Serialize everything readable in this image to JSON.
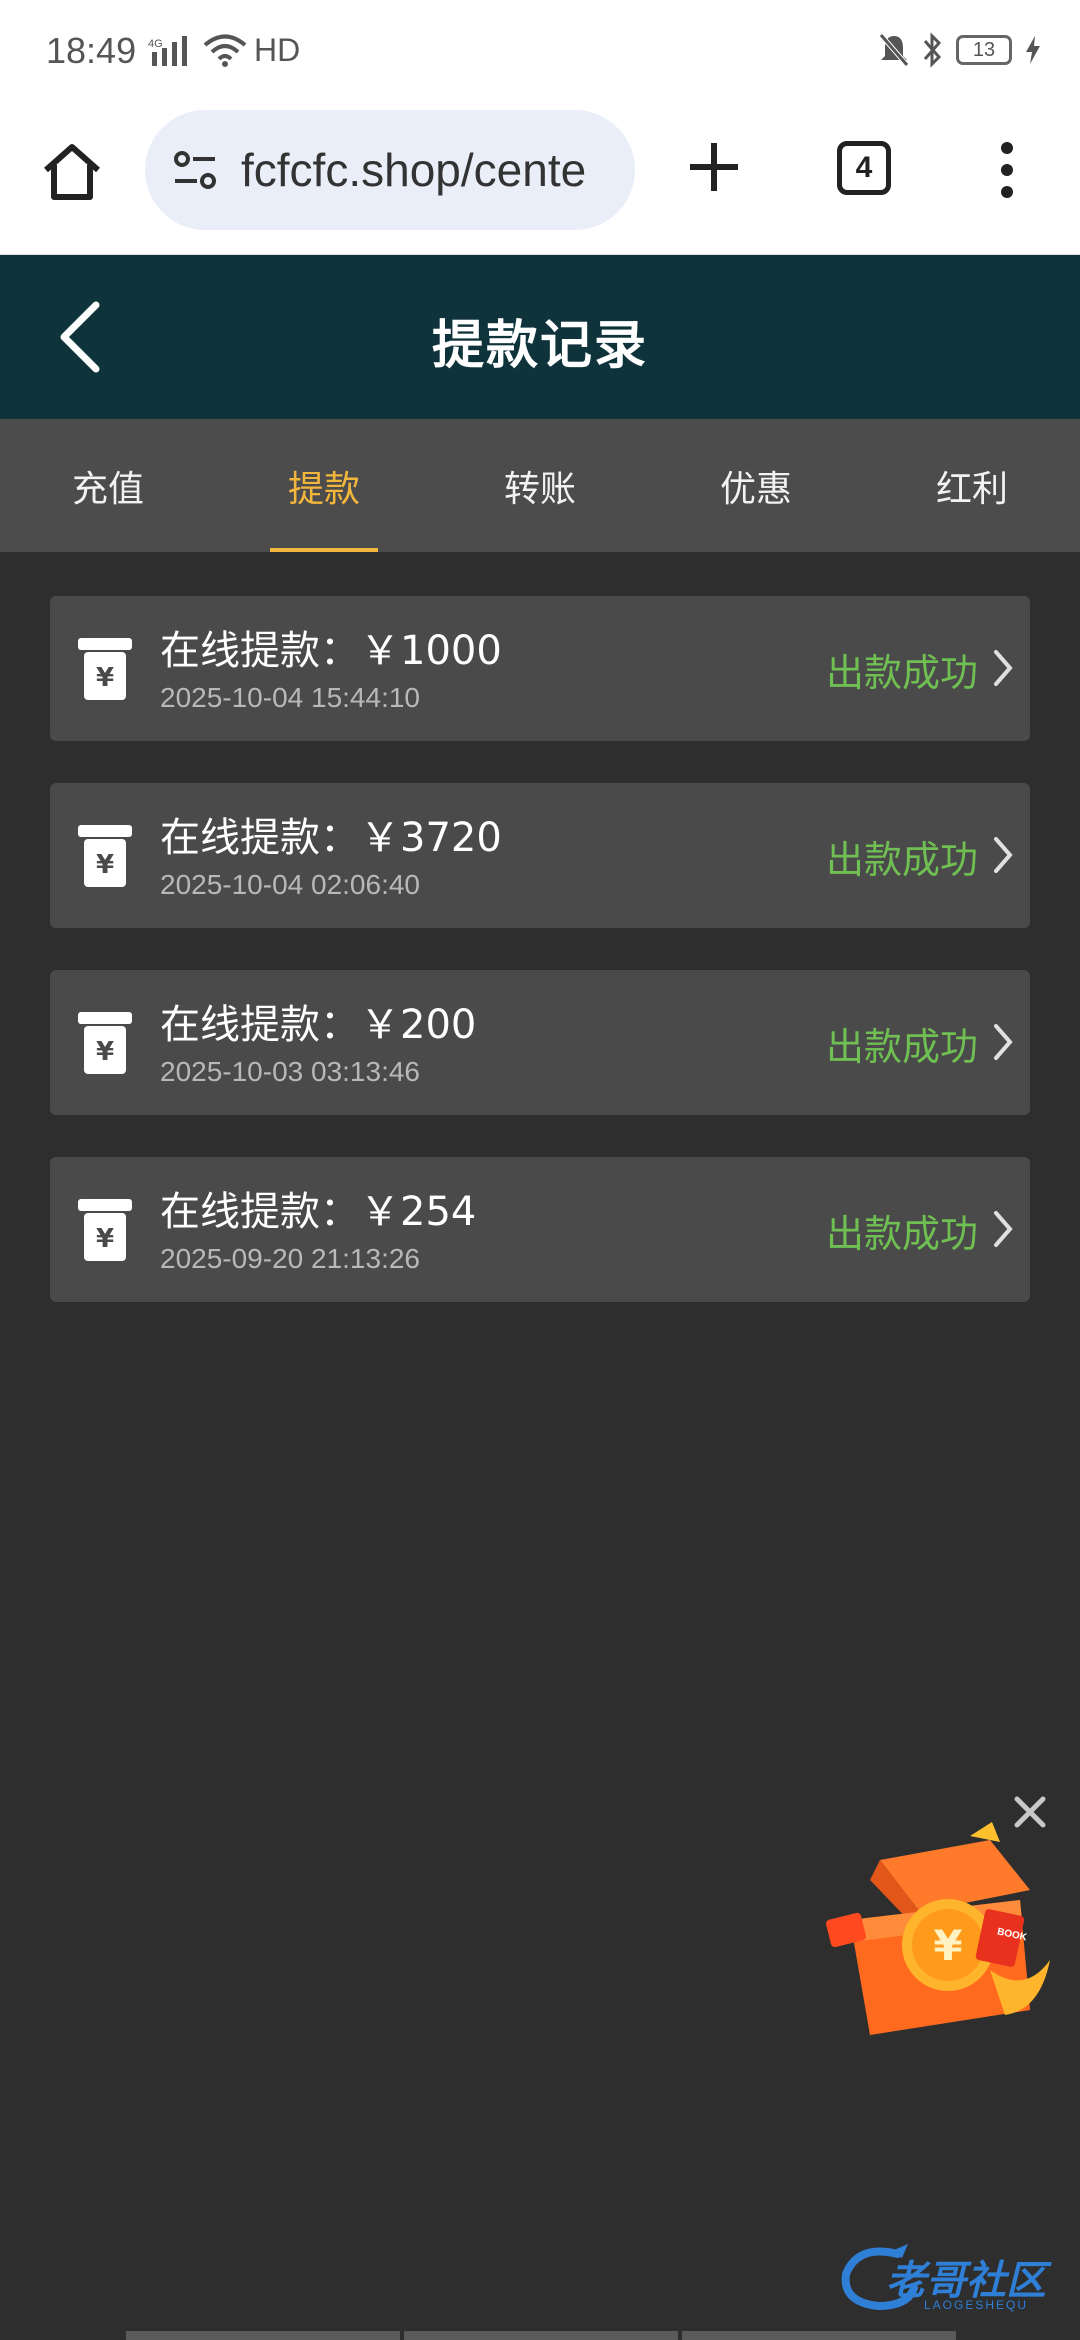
{
  "status_bar": {
    "time": "18:49",
    "network": "4G",
    "hd": "HD",
    "battery": "13"
  },
  "browser": {
    "url": "fcfcfc.shop/cente",
    "tab_count": "4"
  },
  "header": {
    "title": "提款记录"
  },
  "tabs": [
    {
      "label": "充值",
      "active": false
    },
    {
      "label": "提款",
      "active": true
    },
    {
      "label": "转账",
      "active": false
    },
    {
      "label": "优惠",
      "active": false
    },
    {
      "label": "红利",
      "active": false
    }
  ],
  "records": [
    {
      "title": "在线提款：￥1000",
      "time": "2025-10-04 15:44:10",
      "status": "出款成功"
    },
    {
      "title": "在线提款：￥3720",
      "time": "2025-10-04 02:06:40",
      "status": "出款成功"
    },
    {
      "title": "在线提款：￥200",
      "time": "2025-10-03 03:13:46",
      "status": "出款成功"
    },
    {
      "title": "在线提款：￥254",
      "time": "2025-09-20 21:13:26",
      "status": "出款成功"
    }
  ],
  "watermark": {
    "text": "老哥社区",
    "sub": "LAOGESHEQU"
  },
  "colors": {
    "header_bg": "#0e333b",
    "tab_active": "#f3b63d",
    "status_success": "#6fbf52",
    "page_bg": "#2e2e2e",
    "card_bg": "#4a4a4a"
  },
  "icons": [
    "home-icon",
    "site-settings-icon",
    "plus-icon",
    "tab-switcher-icon",
    "more-vert-icon",
    "back-arrow-icon",
    "withdraw-yuan-icon",
    "chevron-right-icon",
    "close-icon",
    "gift-box-icon"
  ]
}
